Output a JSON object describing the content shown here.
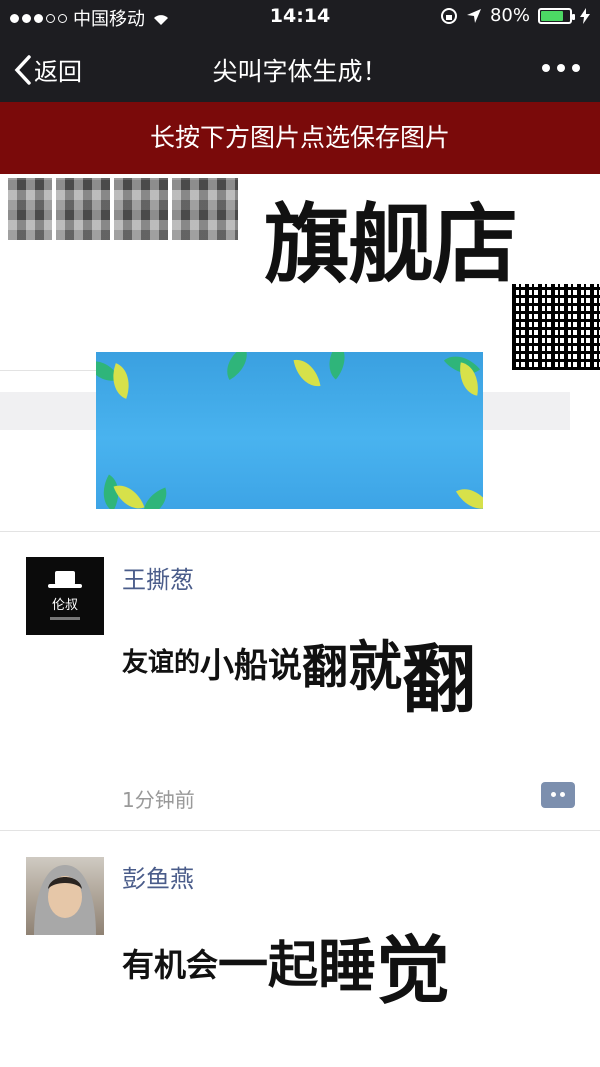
{
  "status_bar": {
    "carrier": "中国移动",
    "time": "14:14",
    "battery": "80%",
    "battery_level": 0.8
  },
  "nav": {
    "back_label": "返回",
    "title": "尖叫字体生成！"
  },
  "banner": {
    "text": "长按下方图片点选保存图片"
  },
  "shop": {
    "suffix": "旗舰店"
  },
  "posts": [
    {
      "username": "王撕葱",
      "text_parts": [
        "友谊的",
        "小船说",
        "翻",
        "就",
        "翻"
      ],
      "time": "1分钟前",
      "avatar": "ghost-hat-avatar"
    },
    {
      "username": "彭鱼燕",
      "text_parts": [
        "有机会",
        "一起",
        "睡",
        "觉"
      ],
      "avatar": "person-photo-avatar"
    }
  ],
  "icons": {
    "back": "chevron-left-icon",
    "more": "more-dots-icon",
    "wifi": "wifi-icon",
    "location": "location-arrow-icon",
    "lock_rotation": "rotation-lock-icon",
    "charging": "charging-bolt-icon",
    "comment": "comment-icon"
  },
  "colors": {
    "bar_bg": "#1d1d21",
    "banner_bg": "#7a0a0a",
    "username": "#4a5c8a",
    "battery": "#4cd964"
  }
}
